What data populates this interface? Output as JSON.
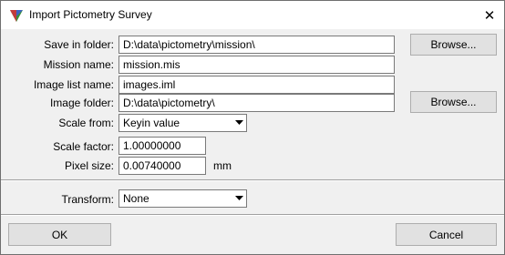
{
  "window": {
    "title": "Import Pictometry Survey",
    "close_glyph": "✕",
    "app_icon": "triangle-logo-icon"
  },
  "form": {
    "save_in_folder": {
      "label": "Save in folder:",
      "value": "D:\\data\\pictometry\\mission\\",
      "browse": "Browse..."
    },
    "mission_name": {
      "label": "Mission name:",
      "value": "mission.mis"
    },
    "image_list_name": {
      "label": "Image list name:",
      "value": "images.iml"
    },
    "image_folder": {
      "label": "Image folder:",
      "value": "D:\\data\\pictometry\\",
      "browse": "Browse..."
    },
    "scale_from": {
      "label": "Scale from:",
      "value": "Keyin value"
    },
    "scale_factor": {
      "label": "Scale factor:",
      "value": "1.00000000"
    },
    "pixel_size": {
      "label": "Pixel size:",
      "value": "0.00740000",
      "unit": "mm"
    },
    "transform": {
      "label": "Transform:",
      "value": "None"
    }
  },
  "buttons": {
    "ok": "OK",
    "cancel": "Cancel"
  },
  "colors": {
    "dialog_bg": "#f0f0f0",
    "titlebar_bg": "#ffffff",
    "button_bg": "#e1e1e1",
    "field_border": "#7a7a7a"
  }
}
